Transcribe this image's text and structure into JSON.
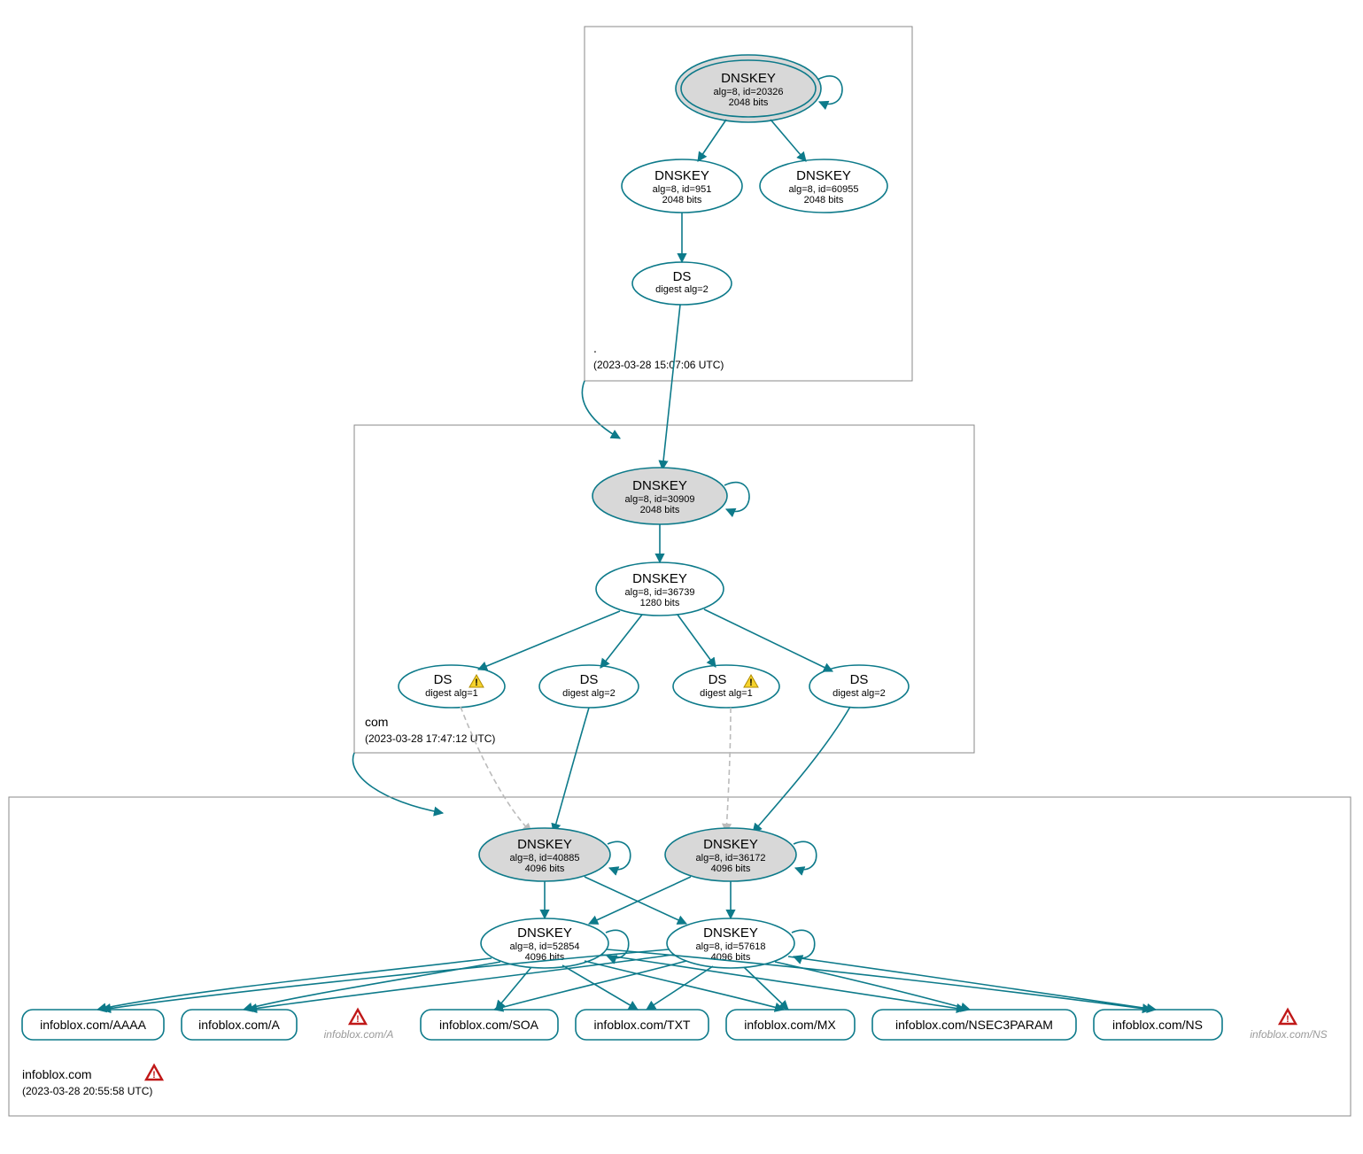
{
  "zones": {
    "root": {
      "name": ".",
      "timestamp": "(2023-03-28 15:07:06 UTC)"
    },
    "com": {
      "name": "com",
      "timestamp": "(2023-03-28 17:47:12 UTC)"
    },
    "target": {
      "name": "infoblox.com",
      "timestamp": "(2023-03-28 20:55:58 UTC)"
    }
  },
  "nodes": {
    "root_ksk": {
      "title": "DNSKEY",
      "sub1": "alg=8, id=20326",
      "sub2": "2048 bits"
    },
    "root_zsk1": {
      "title": "DNSKEY",
      "sub1": "alg=8, id=951",
      "sub2": "2048 bits"
    },
    "root_zsk2": {
      "title": "DNSKEY",
      "sub1": "alg=8, id=60955",
      "sub2": "2048 bits"
    },
    "root_ds": {
      "title": "DS",
      "sub1": "digest alg=2"
    },
    "com_ksk": {
      "title": "DNSKEY",
      "sub1": "alg=8, id=30909",
      "sub2": "2048 bits"
    },
    "com_zsk": {
      "title": "DNSKEY",
      "sub1": "alg=8, id=36739",
      "sub2": "1280 bits"
    },
    "com_ds1": {
      "title": "DS",
      "sub1": "digest alg=1"
    },
    "com_ds2": {
      "title": "DS",
      "sub1": "digest alg=2"
    },
    "com_ds3": {
      "title": "DS",
      "sub1": "digest alg=1"
    },
    "com_ds4": {
      "title": "DS",
      "sub1": "digest alg=2"
    },
    "t_ksk1": {
      "title": "DNSKEY",
      "sub1": "alg=8, id=40885",
      "sub2": "4096 bits"
    },
    "t_ksk2": {
      "title": "DNSKEY",
      "sub1": "alg=8, id=36172",
      "sub2": "4096 bits"
    },
    "t_zsk1": {
      "title": "DNSKEY",
      "sub1": "alg=8, id=52854",
      "sub2": "4096 bits"
    },
    "t_zsk2": {
      "title": "DNSKEY",
      "sub1": "alg=8, id=57618",
      "sub2": "4096 bits"
    }
  },
  "rrsets": {
    "aaaa": "infoblox.com/AAAA",
    "a": "infoblox.com/A",
    "soa": "infoblox.com/SOA",
    "txt": "infoblox.com/TXT",
    "mx": "infoblox.com/MX",
    "nsec3": "infoblox.com/NSEC3PARAM",
    "ns": "infoblox.com/NS"
  },
  "ghosts": {
    "a": "infoblox.com/A",
    "ns": "infoblox.com/NS"
  },
  "colors": {
    "teal": "#0d7a8a",
    "grey_fill": "#d8d8d8"
  }
}
